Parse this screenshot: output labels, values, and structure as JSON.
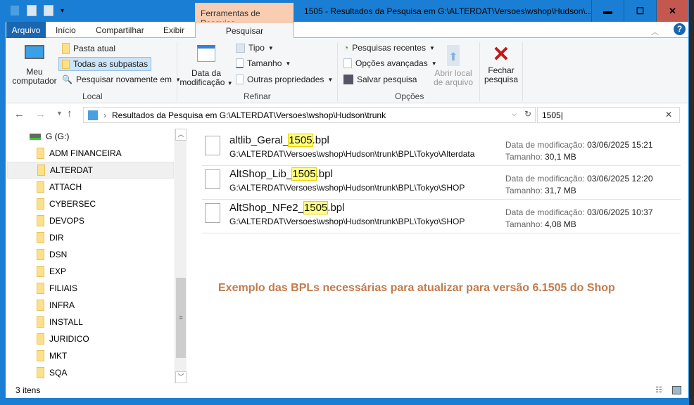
{
  "window": {
    "title": "1505 - Resultados da Pesquisa em G:\\ALTERDAT\\Versoes\\wshop\\Hudson\\...",
    "context_tab": "Ferramentas de Pesquisa",
    "minimize": "▬",
    "maximize": "☐",
    "close": "✕"
  },
  "tabs": [
    "Arquivo",
    "Início",
    "Compartilhar",
    "Exibir",
    "Pesquisar"
  ],
  "ribbon": {
    "local": {
      "my_computer": "Meu computador",
      "current_folder": "Pasta atual",
      "all_subfolders": "Todas as subpastas",
      "search_again": "Pesquisar novamente em",
      "group": "Local"
    },
    "refine": {
      "date_modified": "Data da modificação",
      "type": "Tipo",
      "size": "Tamanho",
      "other_props": "Outras propriedades",
      "group": "Refinar"
    },
    "options": {
      "recent": "Pesquisas recentes",
      "advanced": "Opções avançadas",
      "save": "Salvar pesquisa",
      "open_location": "Abrir local de arquivo",
      "group": "Opções"
    },
    "close_search": "Fechar pesquisa"
  },
  "address": {
    "path": "Resultados da Pesquisa em G:\\ALTERDAT\\Versoes\\wshop\\Hudson\\trunk",
    "search_value": "1505"
  },
  "tree": {
    "drive": "G (G:)",
    "folders": [
      "ADM FINANCEIRA",
      "ALTERDAT",
      "ATTACH",
      "CYBERSEC",
      "DEVOPS",
      "DIR",
      "DSN",
      "EXP",
      "FILIAIS",
      "INFRA",
      "INSTALL",
      "JURIDICO",
      "MKT",
      "SQA"
    ],
    "selected": "ALTERDAT"
  },
  "results": [
    {
      "prefix": "altlib_Geral_",
      "match": "1505",
      "suffix": ".bpl",
      "path": "G:\\ALTERDAT\\Versoes\\wshop\\Hudson\\trunk\\BPL\\Tokyo\\Alterdata",
      "date_label": "Data de modificação:",
      "date": "03/06/2025 15:21",
      "size_label": "Tamanho:",
      "size": "30,1 MB"
    },
    {
      "prefix": "AltShop_Lib_",
      "match": "1505",
      "suffix": ".bpl",
      "path": "G:\\ALTERDAT\\Versoes\\wshop\\Hudson\\trunk\\BPL\\Tokyo\\SHOP",
      "date_label": "Data de modificação:",
      "date": "03/06/2025 12:20",
      "size_label": "Tamanho:",
      "size": "31,7 MB"
    },
    {
      "prefix": "AltShop_NFe2_",
      "match": "1505",
      "suffix": ".bpl",
      "path": "G:\\ALTERDAT\\Versoes\\wshop\\Hudson\\trunk\\BPL\\Tokyo\\SHOP",
      "date_label": "Data de modificação:",
      "date": "03/06/2025 10:37",
      "size_label": "Tamanho:",
      "size": "4,08 MB"
    }
  ],
  "annotation": "Exemplo das BPLs necessárias para atualizar para versão 6.1505 do Shop",
  "status": {
    "count": "3 itens"
  }
}
